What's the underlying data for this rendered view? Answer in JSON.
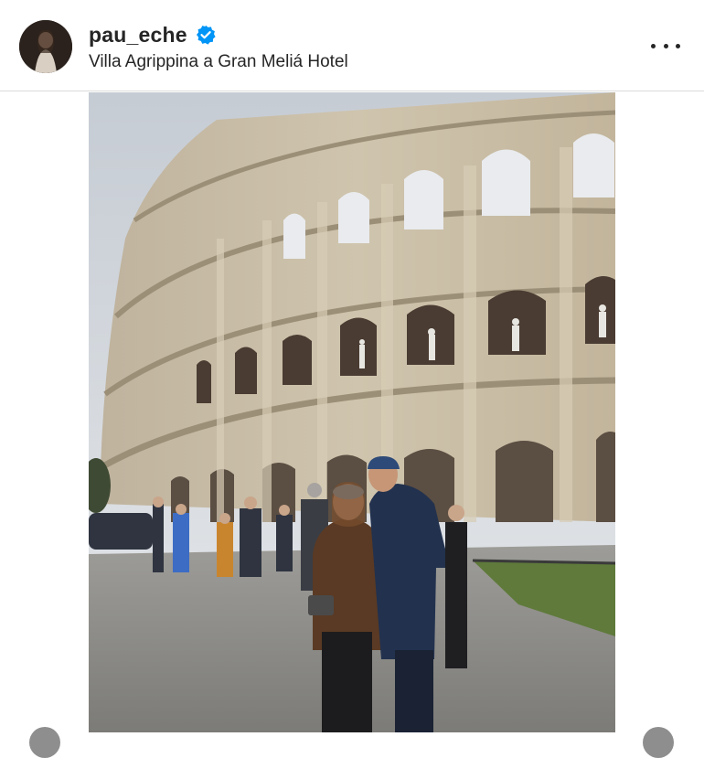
{
  "post": {
    "username": "pau_eche",
    "verified": true,
    "location": "Villa Agrippina a Gran Meliá Hotel",
    "more_icon": "more-horizontal-icon",
    "verified_icon": "verified-badge-icon"
  },
  "colors": {
    "text": "#262626",
    "verified_blue": "#0095f6",
    "divider": "#dbdbdb"
  }
}
